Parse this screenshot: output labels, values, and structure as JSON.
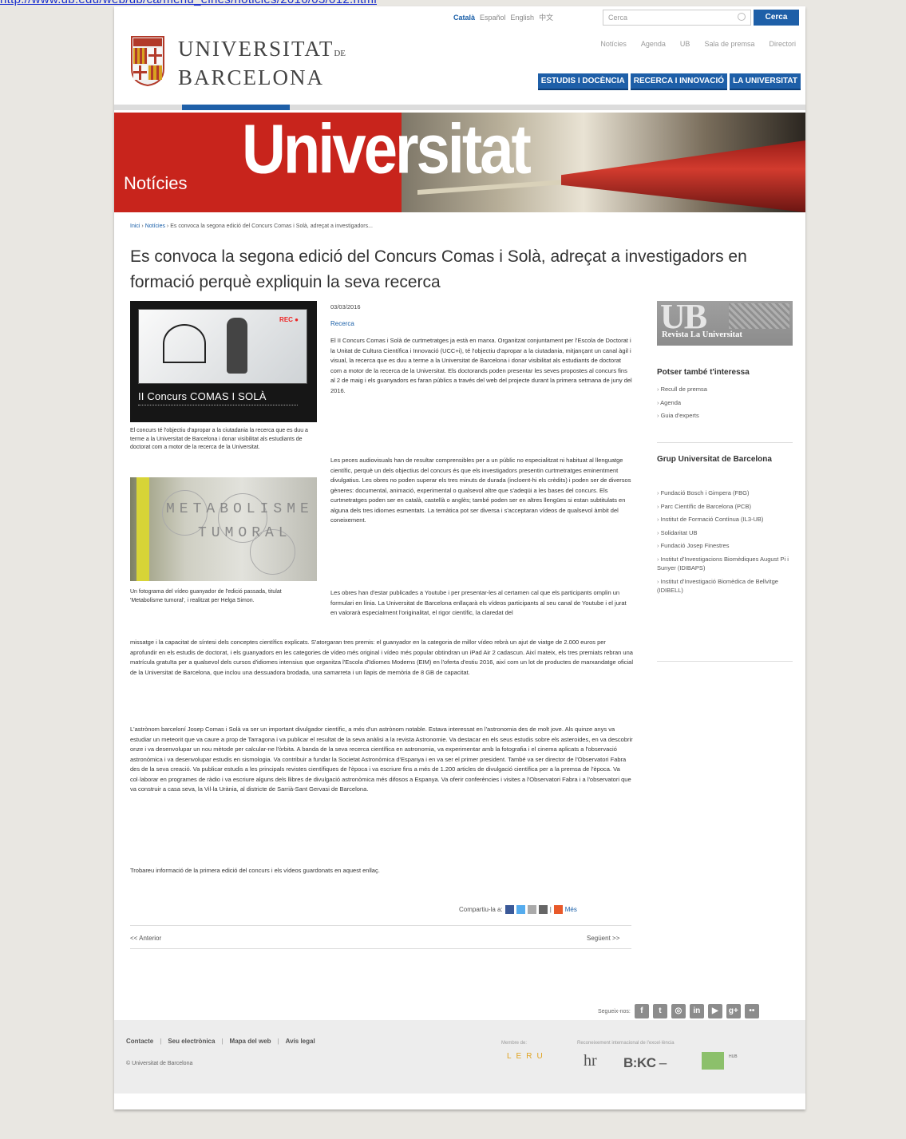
{
  "browser": {
    "url_fragment": "http://www.ub.edu/web/ub/ca/menu_eines/noticies/2016/03/012.html"
  },
  "header": {
    "languages": [
      {
        "label": "Català",
        "current": true
      },
      {
        "label": "Español",
        "current": false
      },
      {
        "label": "English",
        "current": false
      },
      {
        "label": "中文",
        "current": false
      }
    ],
    "search_placeholder": "Cerca",
    "search_button": "Cerca",
    "logo_line1": "UNIVERSITAT",
    "logo_de": "DE",
    "logo_line2": "BARCELONA",
    "top_links": [
      "Notícies",
      "Agenda",
      "UB",
      "Sala de premsa",
      "Directori"
    ],
    "main_nav": [
      "ESTUDIS I DOCÈNCIA",
      "RECERCA I INNOVACIÓ",
      "LA UNIVERSITAT"
    ]
  },
  "banner": {
    "word": "Universitat",
    "section": "Notícies"
  },
  "breadcrumb": [
    "Inici",
    "Notícies",
    "Es convoca la segona edició del Concurs Comas i Solà, adreçat a investigadors..."
  ],
  "article": {
    "title": "Es convoca la segona edició del Concurs Comas i Solà, adreçat a investigadors en formació perquè expliquin la seva recerca",
    "date": "03/03/2016",
    "category": "Recerca",
    "image1": {
      "rec": "REC ●",
      "text": "II Concurs COMAS I SOLÀ"
    },
    "caption1": "El concurs té l'objectiu d'apropar a la ciutadania la recerca que es duu a terme a la Universitat de Barcelona i donar visibilitat als estudiants de doctorat com a motor de la recerca de la Universitat.",
    "image2": {
      "word1": "METABOLISME",
      "word2": "TUMORAL"
    },
    "caption2": "Un fotograma del vídeo guanyador de l'edició passada, titulat 'Metabolisme tumoral', i realitzat per Helga Simon.",
    "p1": "El II Concurs Comas i Solà de curtmetratges ja està en marxa. Organitzat conjuntament per l'Escola de Doctorat i la Unitat de Cultura Científica i Innovació (UCC+i), té l'objectiu d'apropar a la ciutadania, mitjançant un canal àgil i visual, la recerca que es duu a terme a la Universitat de Barcelona i donar visibilitat als estudiants de doctorat com a motor de la recerca de la Universitat. Els doctorands poden presentar les seves propostes al concurs fins al 2 de maig i els guanyadors es faran públics a través del web del projecte durant la primera setmana de juny del 2016.",
    "p2": "Les peces audiovisuals han de resultar comprensibles per a un públic no especialitzat ni habituat al llenguatge científic, perquè un dels objectius del concurs és que els investigadors presentin curtmetratges eminentment divulgatius. Les obres no poden superar els tres minuts de durada (incloent-hi els crèdits) i poden ser de diversos gèneres: documental, animació, experimental o qualsevol altre que s'adeqüi a les bases del concurs. Els curtmetratges poden ser en català, castellà o anglès; també poden ser en altres llengües si estan subtitulats en alguna dels tres idiomes esmentats. La temàtica pot ser diversa i s'acceptaran vídeos de qualsevol àmbit del coneixement.",
    "p3a": "Les obres han d'estar publicades a Youtube i per presentar-les al certamen cal que els participants omplin un formulari en línia. La Universitat de Barcelona enllaçarà els vídeos participants al seu canal de Youtube i el jurat en valorarà especialment l'originalitat, el rigor científic, la claredat del",
    "p3b": "missatge i la capacitat de síntesi dels conceptes científics explicats. S'atorgaran tres premis: el guanyador en la categoria de millor vídeo rebrà un ajut de viatge de 2.000 euros per aprofundir en els estudis de doctorat, i els guanyadors en les categories de vídeo més original i vídeo més popular obtindran un iPad Air 2 cadascun. Així mateix, els tres premiats rebran una matrícula gratuïta per a qualsevol dels cursos d'idiomes intensius que organitza l'Escola d'Idiomes Moderns (EIM) en l'oferta d'estiu 2016, així com un lot de productes de marxandatge oficial de la Universitat de Barcelona, que inclou una dessuadora brodada, una samarreta i un llapis de memòria de 8 GB de capacitat.",
    "p4": "L'astrònom barceloní Josep Comas i Solà va ser un important divulgador científic, a més d'un astrònom notable. Estava interessat en l'astronomia des de molt jove. Als quinze anys va estudiar un meteorit que va caure a prop de Tarragona i va publicar el resultat de la seva anàlisi a la revista Astronomie. Va destacar en els seus estudis sobre els asteroides, en va descobrir onze i va desenvolupar un nou mètode per calcular-ne l'òrbita. A banda de la seva recerca científica en astronomia, va experimentar amb la fotografia i el cinema aplicats a l'observació astronòmica i va desenvolupar estudis en sismologia. Va contribuir a fundar la Societat Astronòmica d'Espanya i en va ser el primer president. També va ser director de l'Observatori Fabra des de la seva creació. Va publicar estudis a les principals revistes científiques de l'època i va escriure fins a més de 1.200 articles de divulgació científica per a la premsa de l'època. Va col·laborar en programes de ràdio i va escriure alguns dels llibres de divulgació astronòmica més difosos a Espanya. Va oferir conferències i visites a l'Observatori Fabra i a l'observatori que va construir a casa seva, la Vil·la Urània, al districte de Sarrià-Sant Gervasi de Barcelona.",
    "p5": "Trobareu informació de la primera edició del concurs i els vídeos guardonats en aquest enllaç.",
    "share_label": "Compartiu-la a:",
    "share_more": "Més",
    "prev": "<< Anterior",
    "next": "Següent >>"
  },
  "sidebar": {
    "revista_big": "UB",
    "revista_title": "Revista La Universitat",
    "h1": "Potser també t'interessa",
    "list1": [
      "Recull de premsa",
      "Agenda",
      "Guia d'experts"
    ],
    "h2": "Grup Universitat de Barcelona",
    "list2": [
      "Fundació Bosch i Gimpera (FBG)",
      "Parc Científic de Barcelona (PCB)",
      "Institut de Formació Contínua (IL3-UB)",
      "Solidaritat UB",
      "Fundació Josep Finestres",
      "Institut d'Investigacions Biomèdiques August Pi i Sunyer (IDIBAPS)",
      "Institut d'Investigació Biomèdica de Bellvitge (IDIBELL)"
    ]
  },
  "footer": {
    "follow_label": "Segueix-nos:",
    "social_icons": [
      "facebook-icon",
      "twitter-icon",
      "instagram-icon",
      "linkedin-icon",
      "youtube-icon",
      "google-plus-icon",
      "flickr-icon"
    ],
    "links": [
      "Contacte",
      "Seu electrònica",
      "Mapa del web",
      "Avís legal"
    ],
    "copyright": "© Universitat de Barcelona",
    "membre": "Membre de:",
    "leru": "LERU",
    "reconeixement": "Reconeixement internacional de l'excel·lència",
    "hr": "hr",
    "bkc": "B:KC",
    "hub": "HUB"
  },
  "colors": {
    "accent": "#1e5fa8",
    "banner_red": "#c8241c",
    "leru": "#e0a321",
    "hub": "#8cc06b"
  }
}
